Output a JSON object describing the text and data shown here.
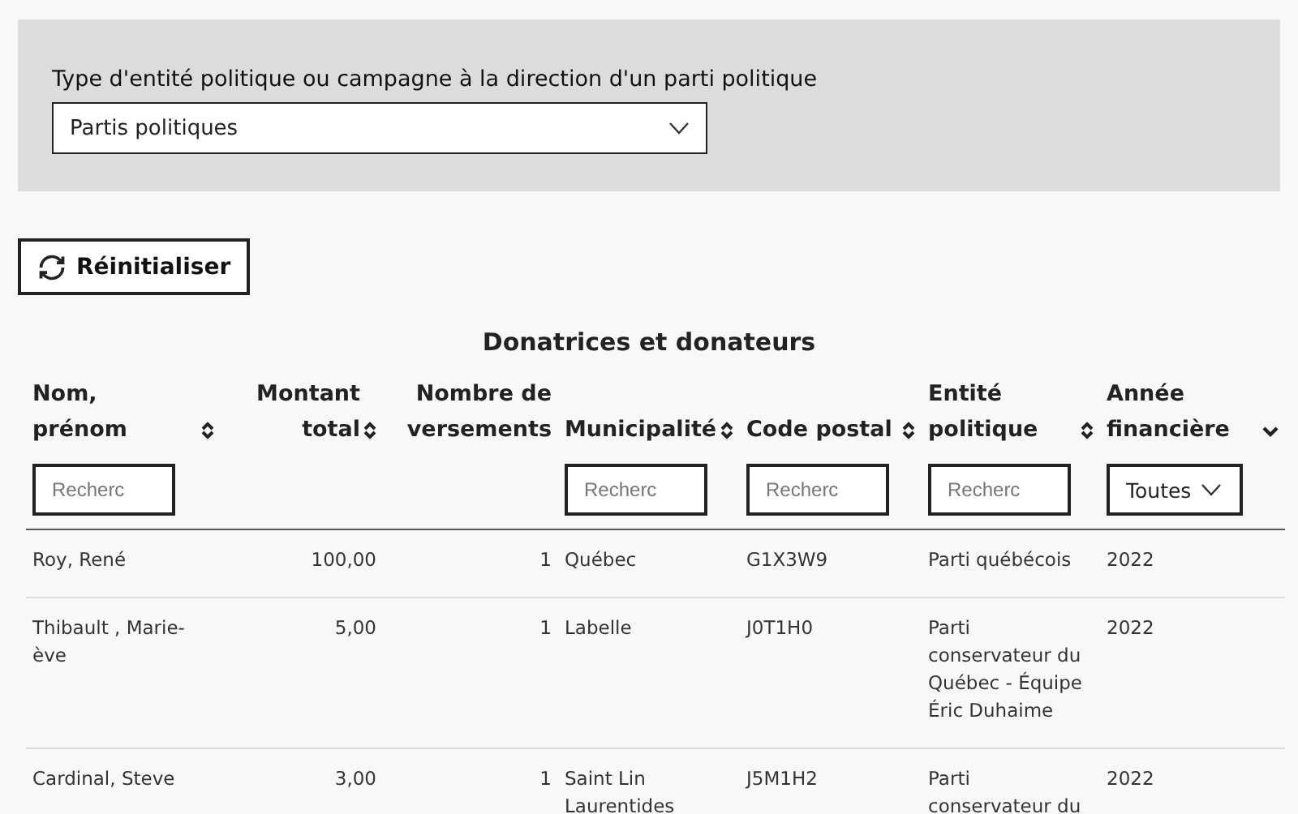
{
  "filter": {
    "label": "Type d'entité politique ou campagne à la direction d'un parti politique",
    "value": "Partis politiques"
  },
  "reset_button": {
    "label": "Réinitialiser"
  },
  "table": {
    "title": "Donatrices et donateurs",
    "columns": [
      {
        "label": "Nom, prénom",
        "kind": "text",
        "placeholder": "Recherc"
      },
      {
        "label": "Montant total",
        "kind": "amount"
      },
      {
        "label": "Nombre de versements",
        "kind": "count"
      },
      {
        "label": "Municipalité",
        "kind": "text",
        "placeholder": "Recherc"
      },
      {
        "label": "Code postal",
        "kind": "text",
        "placeholder": "Recherc"
      },
      {
        "label": "Entité politique",
        "kind": "text",
        "placeholder": "Recherc"
      },
      {
        "label": "Année financière",
        "kind": "year",
        "value": "Toutes"
      }
    ],
    "rows": [
      [
        "Roy, René",
        "100,00",
        "1",
        "Québec",
        "G1X3W9",
        "Parti québécois",
        "2022"
      ],
      [
        "Thibault , Marie-ève",
        "5,00",
        "1",
        "Labelle",
        "J0T1H0",
        "Parti conservateur du Québec - Équipe Éric Duhaime",
        "2022"
      ],
      [
        "Cardinal, Steve",
        "3,00",
        "1",
        "Saint Lin Laurentides",
        "J5M1H2",
        "Parti conservateur du",
        "2022"
      ]
    ]
  }
}
